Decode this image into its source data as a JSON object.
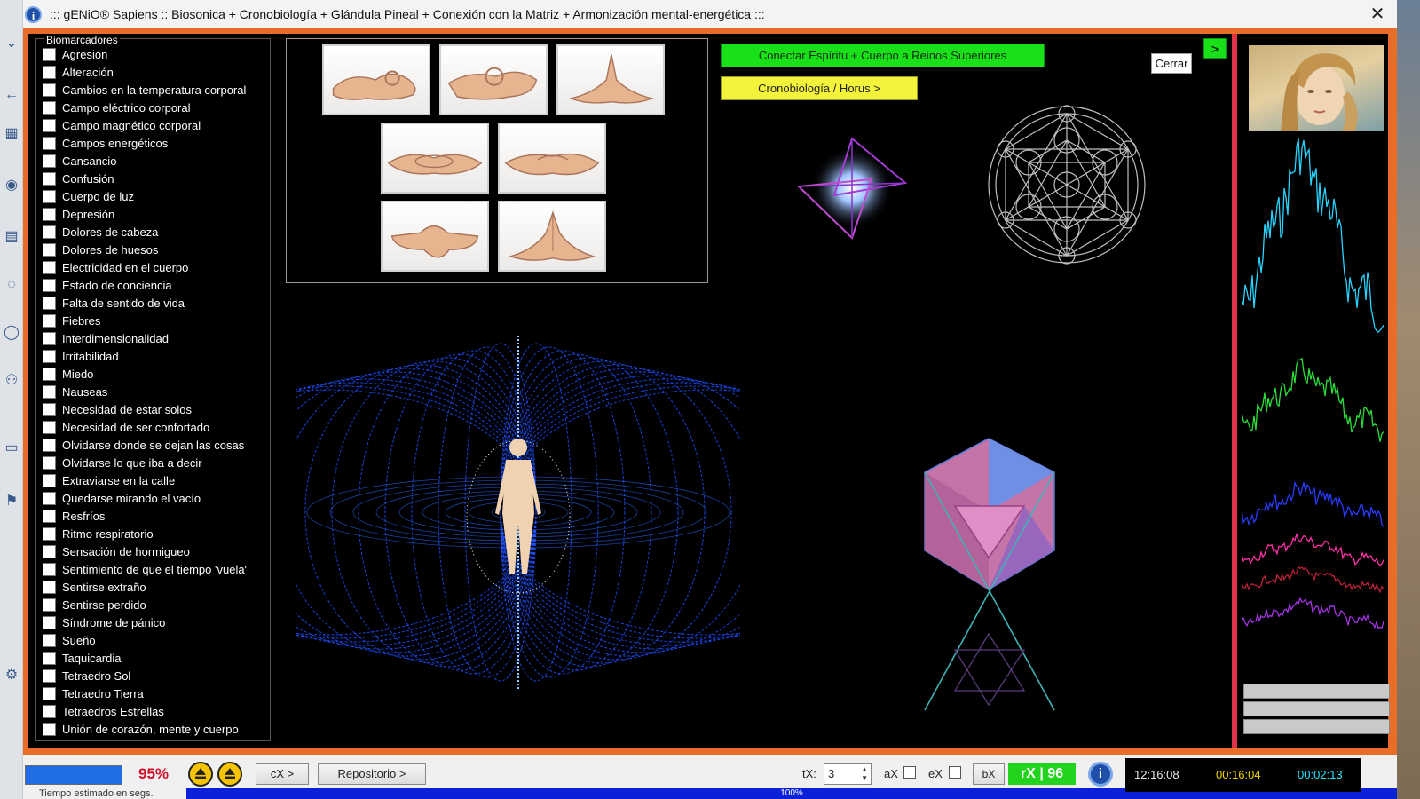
{
  "window": {
    "title": "::: gENiO® Sapiens :: Biosonica + Cronobiología + Glándula Pineal + Conexión con la Matriz + Armonización mental-energética :::",
    "close_glyph": "✕"
  },
  "biomarkers": {
    "legend": "Biomarcadores",
    "items": [
      "Agresión",
      "Alteración",
      "Cambios en la temperatura corporal",
      "Campo eléctrico corporal",
      "Campo magnético corporal",
      "Campos energéticos",
      "Cansancio",
      "Confusión",
      "Cuerpo de luz",
      "Depresión",
      "Dolores de cabeza",
      "Dolores de huesos",
      "Electricidad en el cuerpo",
      "Estado de conciencia",
      "Falta de sentido de vida",
      "Fiebres",
      "Interdimensionalidad",
      "Irritabilidad",
      "Miedo",
      "Nauseas",
      "Necesidad de estar solos",
      "Necesidad de ser confortado",
      "Olvidarse donde se dejan las cosas",
      "Olvidarse lo que iba a decir",
      "Extraviarse en la calle",
      "Quedarse mirando el vacío",
      "Resfríos",
      "Ritmo respiratorio",
      "Sensación de hormigueo",
      "Sentimiento de que el tiempo 'vuela'",
      "Sentirse extraño",
      "Sentirse perdido",
      "Síndrome de pánico",
      "Sueño",
      "Taquicardia",
      "Tetraedro Sol",
      "Tetraedro Tierra",
      "Tetraedros Estrellas",
      "Unión de corazón, mente y cuerpo"
    ]
  },
  "buttons": {
    "connect": "Conectar Espíritu + Cuerpo a Reinos Superiores",
    "chrono": "Cronobiología / Horus >",
    "next": ">",
    "close": "Cerrar"
  },
  "status": {
    "progress_percent": 95,
    "percent_label": "95%",
    "cx_label": "cX >",
    "repo_label": "Repositorio >",
    "estimate_label": "Tiempo estimado en segs.",
    "footer_percent": "100%",
    "tx_label": "tX:",
    "tx_value": "3",
    "ax_label": "aX",
    "ex_label": "eX",
    "bx_label": "bX",
    "rx_label": "rX | 96",
    "time_clock": "12:16:08",
    "time_elapsed": "00:16:04",
    "time_remaining": "00:02:13"
  },
  "colors": {
    "frame": "#e86d26",
    "side_frame": "#e0334a",
    "green": "#19e019",
    "yellow": "#f3f33b",
    "timer_white": "#ffffff",
    "timer_yellow": "#f2d000",
    "timer_cyan": "#29e4ff"
  }
}
